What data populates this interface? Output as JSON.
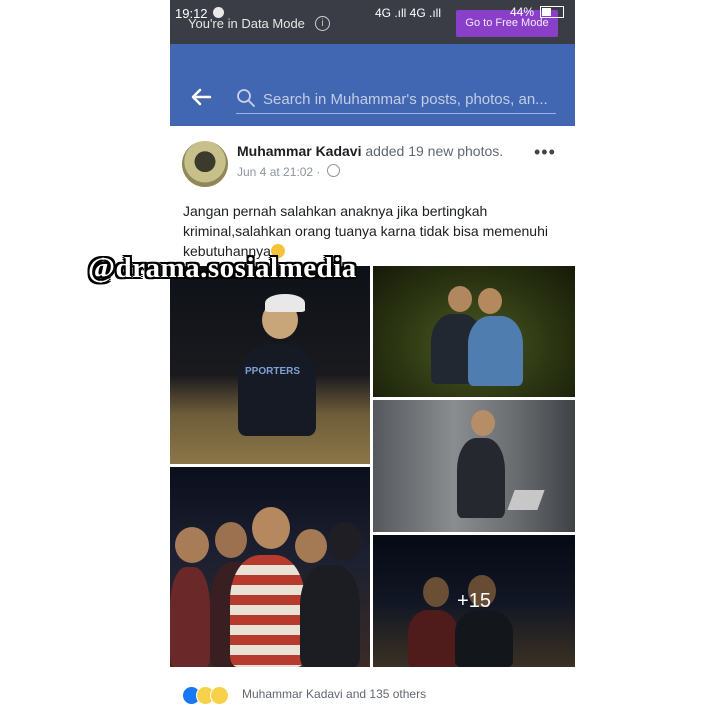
{
  "status_bar": {
    "time": "19:12",
    "data_mode_text": "You're in Data Mode",
    "network": "4G .ıll 4G .ıll",
    "battery": "44%",
    "free_mode_button": "Go to Free Mode"
  },
  "header": {
    "search_placeholder": "Search in Muhammar's posts, photos, an..."
  },
  "post": {
    "author": "Muhammar Kadavi",
    "action": "added 19 new photos.",
    "timestamp": "Jun 4 at 21:02",
    "separator": "·",
    "caption": "Jangan pernah salahkan anaknya jika bertingkah kriminal,salahkan orang tuanya karna tidak bisa memenuhi kebutuhannya",
    "more_photos": "+15",
    "reactions_text": "Muhammar Kadavi and 135 others",
    "reactions": [
      "like-icon",
      "wow-icon",
      "sad-icon"
    ]
  },
  "watermark": "@drama.sosialmedia",
  "colors": {
    "facebook_blue": "#4267b2",
    "status_bar": "#3a3d45",
    "free_mode_purple": "#8a3fc9"
  }
}
